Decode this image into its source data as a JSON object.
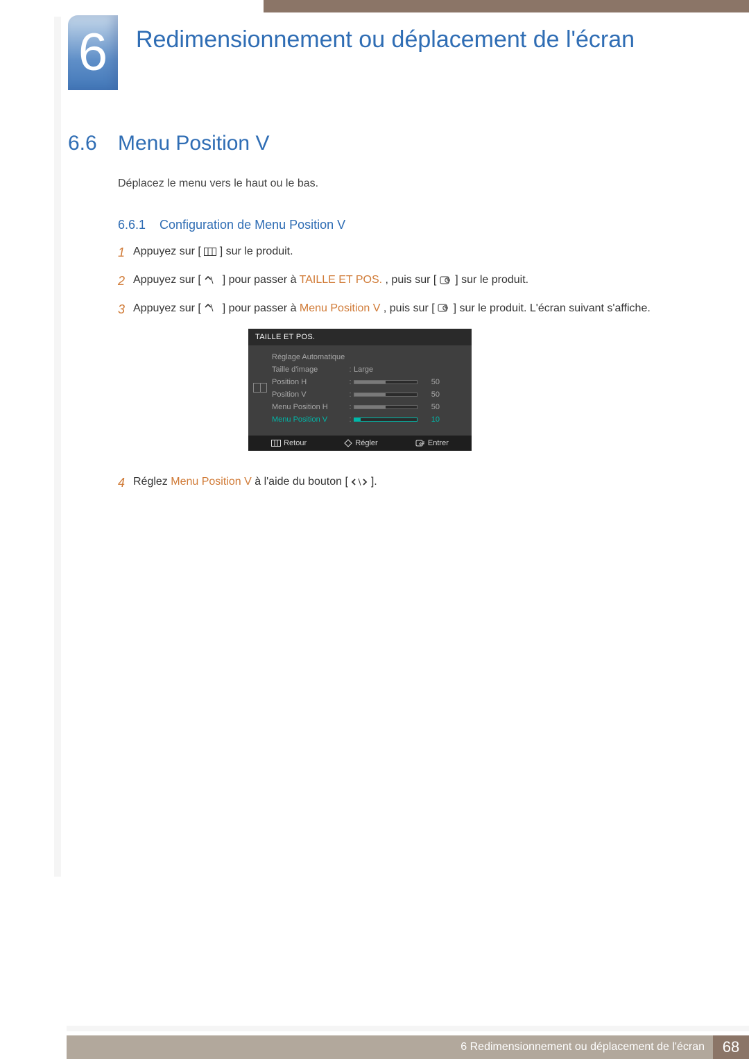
{
  "chapter": {
    "number": "6",
    "title": "Redimensionnement ou déplacement de l'écran"
  },
  "section": {
    "number": "6.6",
    "title": "Menu Position V",
    "intro": "Déplacez le menu vers le haut ou le bas."
  },
  "subsection": {
    "number": "6.6.1",
    "title": "Configuration de Menu Position V"
  },
  "steps": {
    "s1": {
      "num": "1",
      "pre": "Appuyez sur [",
      "post": "] sur le produit."
    },
    "s2": {
      "num": "2",
      "pre": "Appuyez sur [",
      "mid1": "] pour passer à ",
      "link": "TAILLE ET POS.",
      "mid2": ", puis sur [",
      "post": "] sur le produit."
    },
    "s3": {
      "num": "3",
      "pre": "Appuyez sur [",
      "mid1": "] pour passer à ",
      "link": "Menu Position V",
      "mid2": ", puis sur [",
      "post": "] sur le produit. L'écran suivant s'affiche."
    },
    "s4": {
      "num": "4",
      "pre": "Réglez ",
      "link": "Menu Position V",
      "mid": " à l'aide du bouton [",
      "post": "]."
    }
  },
  "osd": {
    "title": "TAILLE ET POS.",
    "rows": {
      "r0": {
        "label": "Réglage Automatique"
      },
      "r1": {
        "label": "Taille d'image",
        "value": "Large"
      },
      "r2": {
        "label": "Position H",
        "num": "50",
        "pct": 50
      },
      "r3": {
        "label": "Position V",
        "num": "50",
        "pct": 50
      },
      "r4": {
        "label": "Menu Position H",
        "num": "50",
        "pct": 50
      },
      "r5": {
        "label": "Menu Position V",
        "num": "10",
        "pct": 10
      }
    },
    "footer": {
      "back": "Retour",
      "adjust": "Régler",
      "enter": "Entrer"
    }
  },
  "footer": {
    "text": "6 Redimensionnement ou déplacement de l'écran",
    "page": "68"
  }
}
